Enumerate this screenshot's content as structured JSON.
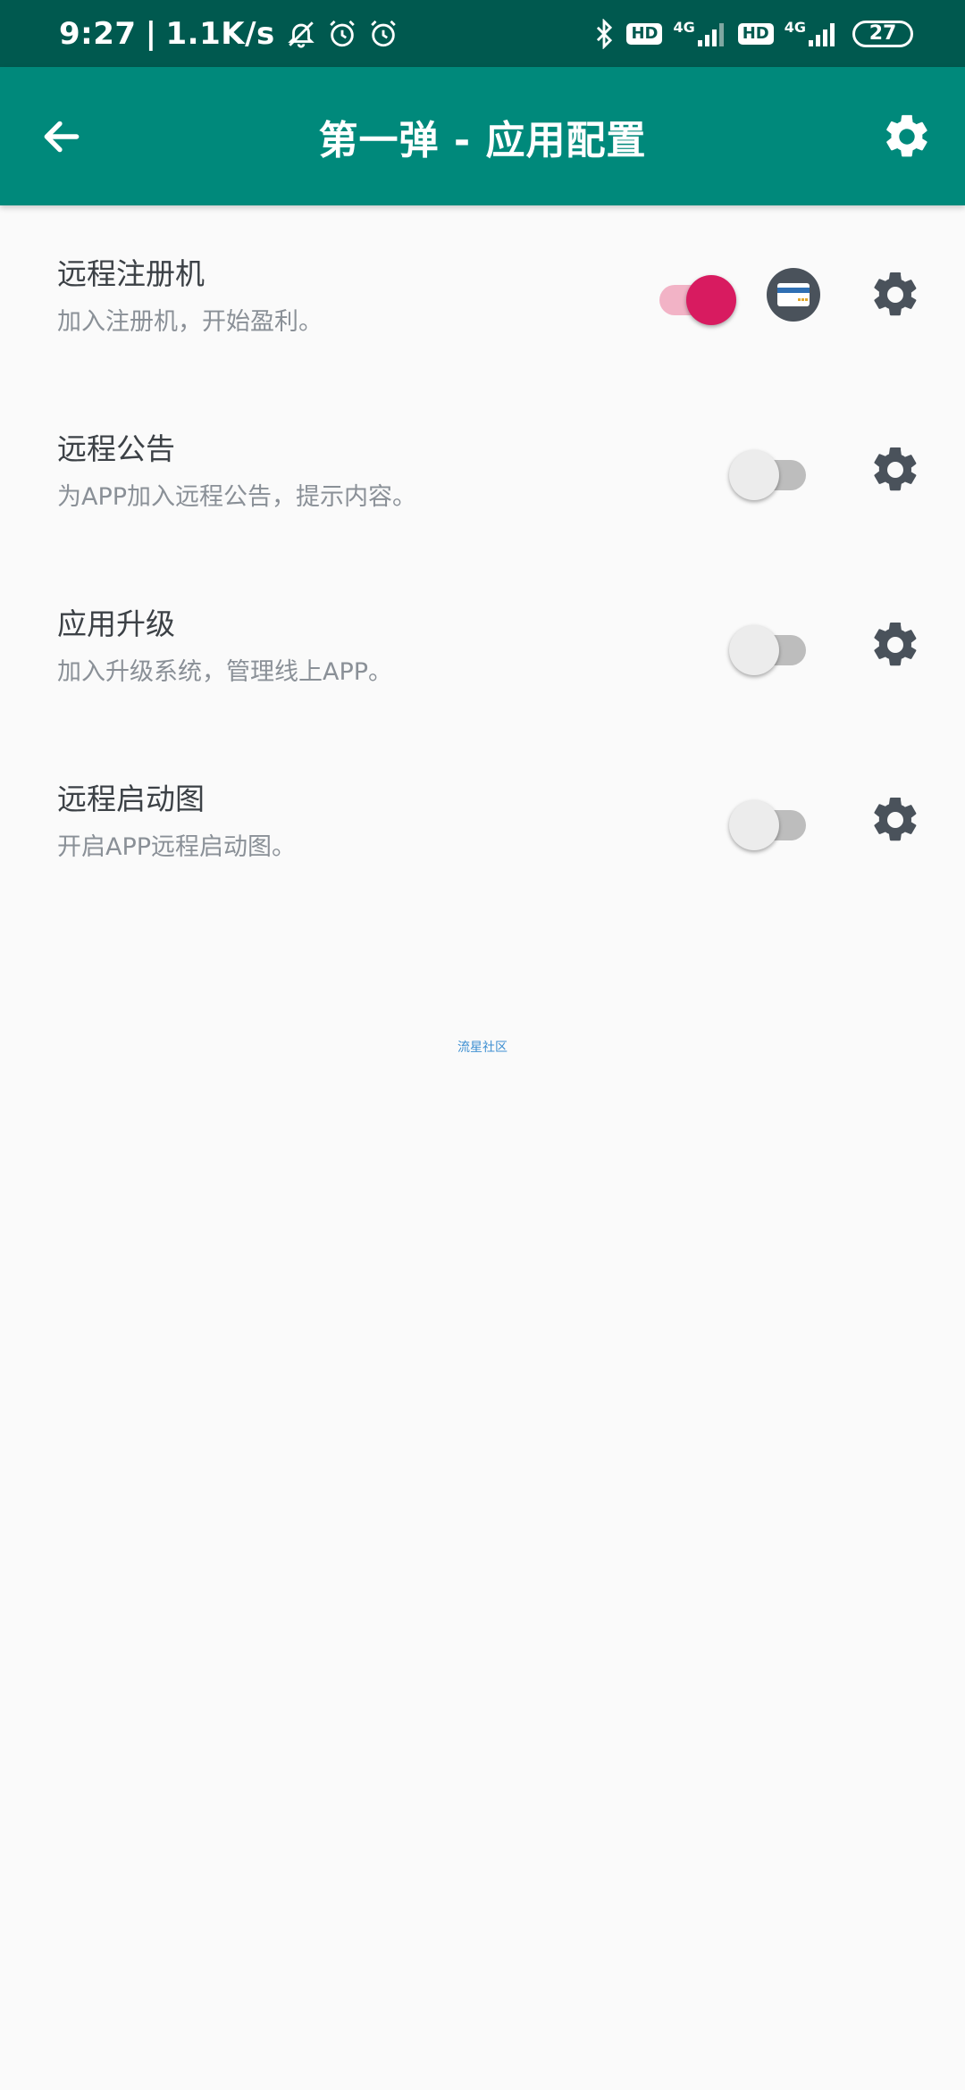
{
  "status_bar": {
    "time": "9:27",
    "separator": "|",
    "net_speed": "1.1K/s",
    "hd1": "HD",
    "net1": "4G",
    "hd2": "HD",
    "net2": "4G",
    "battery": "27",
    "icons": [
      "bell-off-icon",
      "alarm-icon",
      "alarm-icon",
      "bluetooth-icon",
      "signal-icon",
      "signal-icon",
      "battery-icon"
    ]
  },
  "app_bar": {
    "title": "第一弹 - 应用配置",
    "back_icon": "arrow-left-icon",
    "settings_icon": "gear-icon",
    "color": "#00897b"
  },
  "items": [
    {
      "title": "远程注册机",
      "subtitle": "加入注册机，开始盈利。",
      "enabled": true,
      "has_card_button": true
    },
    {
      "title": "远程公告",
      "subtitle": "为APP加入远程公告，提示内容。",
      "enabled": false,
      "has_card_button": false
    },
    {
      "title": "应用升级",
      "subtitle": "加入升级系统，管理线上APP。",
      "enabled": false,
      "has_card_button": false
    },
    {
      "title": "远程启动图",
      "subtitle": "开启APP远程启动图。",
      "enabled": false,
      "has_card_button": false
    }
  ],
  "footer": {
    "link": "流星社区"
  },
  "colors": {
    "status_bar": "#00594f",
    "accent": "#d81b60",
    "icon": "#4a525b"
  }
}
